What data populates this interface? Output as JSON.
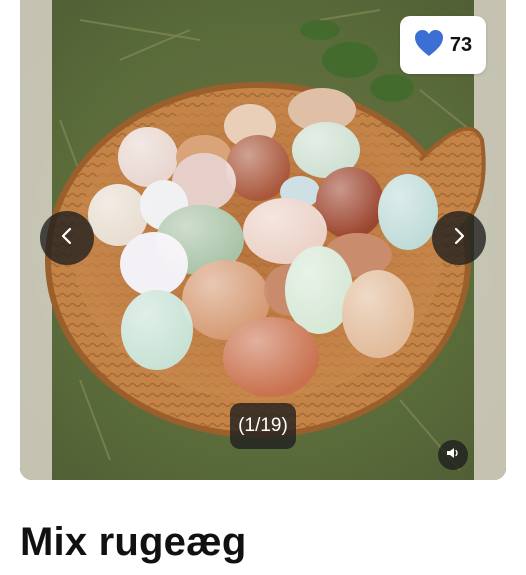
{
  "listing": {
    "title": "Mix rugeæg",
    "likes": "73",
    "image_counter": "(1/19)",
    "photo_subject": "basket of mixed colored eggs on grass"
  },
  "colors": {
    "heart": "#3b6fd4",
    "overlay": "#1e1e1e"
  },
  "icons": {
    "like": "heart-icon",
    "prev": "chevron-left-icon",
    "next": "chevron-right-icon",
    "sound": "speaker-icon"
  }
}
